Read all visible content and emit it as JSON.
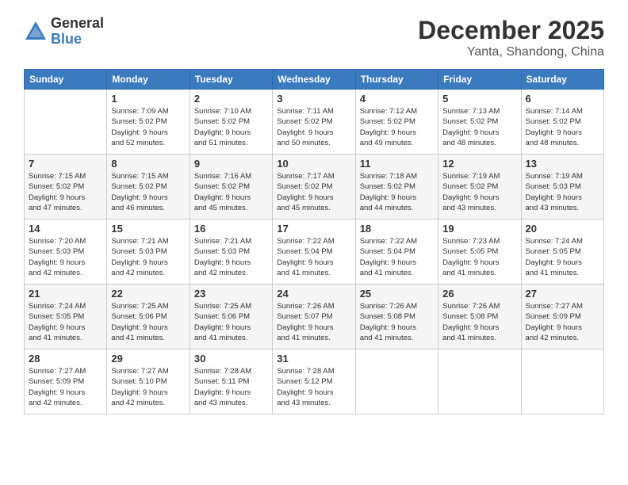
{
  "logo": {
    "general": "General",
    "blue": "Blue"
  },
  "header": {
    "month": "December 2025",
    "location": "Yanta, Shandong, China"
  },
  "weekdays": [
    "Sunday",
    "Monday",
    "Tuesday",
    "Wednesday",
    "Thursday",
    "Friday",
    "Saturday"
  ],
  "weeks": [
    [
      {
        "day": "",
        "info": ""
      },
      {
        "day": "1",
        "info": "Sunrise: 7:09 AM\nSunset: 5:02 PM\nDaylight: 9 hours\nand 52 minutes."
      },
      {
        "day": "2",
        "info": "Sunrise: 7:10 AM\nSunset: 5:02 PM\nDaylight: 9 hours\nand 51 minutes."
      },
      {
        "day": "3",
        "info": "Sunrise: 7:11 AM\nSunset: 5:02 PM\nDaylight: 9 hours\nand 50 minutes."
      },
      {
        "day": "4",
        "info": "Sunrise: 7:12 AM\nSunset: 5:02 PM\nDaylight: 9 hours\nand 49 minutes."
      },
      {
        "day": "5",
        "info": "Sunrise: 7:13 AM\nSunset: 5:02 PM\nDaylight: 9 hours\nand 48 minutes."
      },
      {
        "day": "6",
        "info": "Sunrise: 7:14 AM\nSunset: 5:02 PM\nDaylight: 9 hours\nand 48 minutes."
      }
    ],
    [
      {
        "day": "7",
        "info": "Sunrise: 7:15 AM\nSunset: 5:02 PM\nDaylight: 9 hours\nand 47 minutes."
      },
      {
        "day": "8",
        "info": "Sunrise: 7:15 AM\nSunset: 5:02 PM\nDaylight: 9 hours\nand 46 minutes."
      },
      {
        "day": "9",
        "info": "Sunrise: 7:16 AM\nSunset: 5:02 PM\nDaylight: 9 hours\nand 45 minutes."
      },
      {
        "day": "10",
        "info": "Sunrise: 7:17 AM\nSunset: 5:02 PM\nDaylight: 9 hours\nand 45 minutes."
      },
      {
        "day": "11",
        "info": "Sunrise: 7:18 AM\nSunset: 5:02 PM\nDaylight: 9 hours\nand 44 minutes."
      },
      {
        "day": "12",
        "info": "Sunrise: 7:19 AM\nSunset: 5:02 PM\nDaylight: 9 hours\nand 43 minutes."
      },
      {
        "day": "13",
        "info": "Sunrise: 7:19 AM\nSunset: 5:03 PM\nDaylight: 9 hours\nand 43 minutes."
      }
    ],
    [
      {
        "day": "14",
        "info": "Sunrise: 7:20 AM\nSunset: 5:03 PM\nDaylight: 9 hours\nand 42 minutes."
      },
      {
        "day": "15",
        "info": "Sunrise: 7:21 AM\nSunset: 5:03 PM\nDaylight: 9 hours\nand 42 minutes."
      },
      {
        "day": "16",
        "info": "Sunrise: 7:21 AM\nSunset: 5:03 PM\nDaylight: 9 hours\nand 42 minutes."
      },
      {
        "day": "17",
        "info": "Sunrise: 7:22 AM\nSunset: 5:04 PM\nDaylight: 9 hours\nand 41 minutes."
      },
      {
        "day": "18",
        "info": "Sunrise: 7:22 AM\nSunset: 5:04 PM\nDaylight: 9 hours\nand 41 minutes."
      },
      {
        "day": "19",
        "info": "Sunrise: 7:23 AM\nSunset: 5:05 PM\nDaylight: 9 hours\nand 41 minutes."
      },
      {
        "day": "20",
        "info": "Sunrise: 7:24 AM\nSunset: 5:05 PM\nDaylight: 9 hours\nand 41 minutes."
      }
    ],
    [
      {
        "day": "21",
        "info": "Sunrise: 7:24 AM\nSunset: 5:05 PM\nDaylight: 9 hours\nand 41 minutes."
      },
      {
        "day": "22",
        "info": "Sunrise: 7:25 AM\nSunset: 5:06 PM\nDaylight: 9 hours\nand 41 minutes."
      },
      {
        "day": "23",
        "info": "Sunrise: 7:25 AM\nSunset: 5:06 PM\nDaylight: 9 hours\nand 41 minutes."
      },
      {
        "day": "24",
        "info": "Sunrise: 7:26 AM\nSunset: 5:07 PM\nDaylight: 9 hours\nand 41 minutes."
      },
      {
        "day": "25",
        "info": "Sunrise: 7:26 AM\nSunset: 5:08 PM\nDaylight: 9 hours\nand 41 minutes."
      },
      {
        "day": "26",
        "info": "Sunrise: 7:26 AM\nSunset: 5:08 PM\nDaylight: 9 hours\nand 41 minutes."
      },
      {
        "day": "27",
        "info": "Sunrise: 7:27 AM\nSunset: 5:09 PM\nDaylight: 9 hours\nand 42 minutes."
      }
    ],
    [
      {
        "day": "28",
        "info": "Sunrise: 7:27 AM\nSunset: 5:09 PM\nDaylight: 9 hours\nand 42 minutes."
      },
      {
        "day": "29",
        "info": "Sunrise: 7:27 AM\nSunset: 5:10 PM\nDaylight: 9 hours\nand 42 minutes."
      },
      {
        "day": "30",
        "info": "Sunrise: 7:28 AM\nSunset: 5:11 PM\nDaylight: 9 hours\nand 43 minutes."
      },
      {
        "day": "31",
        "info": "Sunrise: 7:28 AM\nSunset: 5:12 PM\nDaylight: 9 hours\nand 43 minutes."
      },
      {
        "day": "",
        "info": ""
      },
      {
        "day": "",
        "info": ""
      },
      {
        "day": "",
        "info": ""
      }
    ]
  ]
}
